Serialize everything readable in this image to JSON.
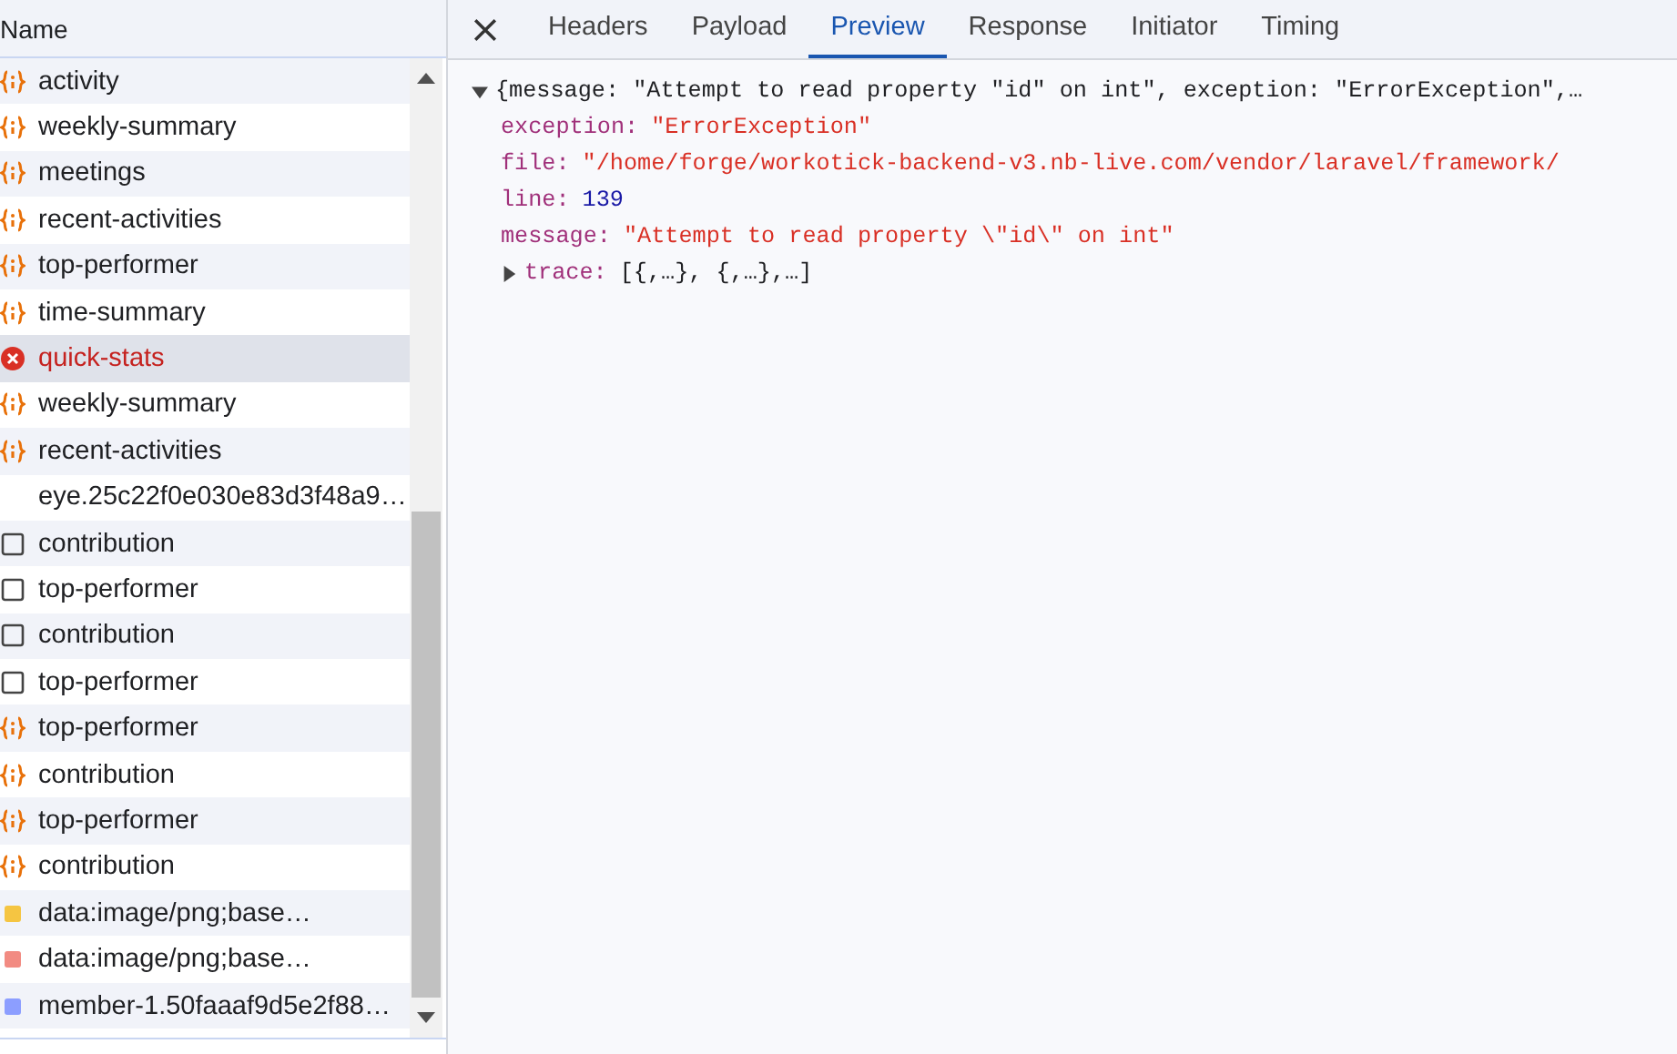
{
  "requests": {
    "header": "Name",
    "rows": [
      {
        "name": "activity",
        "kind": "fetch",
        "selected": false
      },
      {
        "name": "weekly-summary",
        "kind": "fetch",
        "selected": false
      },
      {
        "name": "meetings",
        "kind": "fetch",
        "selected": false
      },
      {
        "name": "recent-activities",
        "kind": "fetch",
        "selected": false
      },
      {
        "name": "top-performer",
        "kind": "fetch",
        "selected": false
      },
      {
        "name": "time-summary",
        "kind": "fetch",
        "selected": false
      },
      {
        "name": "quick-stats",
        "kind": "error",
        "selected": true
      },
      {
        "name": "weekly-summary",
        "kind": "fetch",
        "selected": false
      },
      {
        "name": "recent-activities",
        "kind": "fetch",
        "selected": false
      },
      {
        "name": "eye.25c22f0e030e83d3f48a9…",
        "kind": "other",
        "selected": false
      },
      {
        "name": "contribution",
        "kind": "document",
        "selected": false
      },
      {
        "name": "top-performer",
        "kind": "document",
        "selected": false
      },
      {
        "name": "contribution",
        "kind": "document",
        "selected": false
      },
      {
        "name": "top-performer",
        "kind": "document",
        "selected": false
      },
      {
        "name": "top-performer",
        "kind": "fetch",
        "selected": false
      },
      {
        "name": "contribution",
        "kind": "fetch",
        "selected": false
      },
      {
        "name": "top-performer",
        "kind": "fetch",
        "selected": false
      },
      {
        "name": "contribution",
        "kind": "fetch",
        "selected": false
      },
      {
        "name": "data:image/png;base…",
        "kind": "image",
        "color": "#f5c542",
        "selected": false
      },
      {
        "name": "data:image/png;base…",
        "kind": "image",
        "color": "#f28b82",
        "selected": false
      },
      {
        "name": "member-1.50faaaf9d5e2f88…",
        "kind": "image",
        "color": "#8c9eff",
        "selected": false
      }
    ]
  },
  "tabs": [
    {
      "label": "Headers",
      "selected": false
    },
    {
      "label": "Payload",
      "selected": false
    },
    {
      "label": "Preview",
      "selected": true
    },
    {
      "label": "Response",
      "selected": false
    },
    {
      "label": "Initiator",
      "selected": false
    },
    {
      "label": "Timing",
      "selected": false
    }
  ],
  "preview": {
    "summary": "{message: \"Attempt to read property \"id\" on int\", exception: \"ErrorException\",…",
    "expanded": true,
    "properties": [
      {
        "key": "exception:",
        "value": "\"ErrorException\"",
        "kind": "string"
      },
      {
        "key": "file:",
        "value": "\"/home/forge/workotick-backend-v3.nb-live.com/vendor/laravel/framework/",
        "kind": "string"
      },
      {
        "key": "line:",
        "value": "139",
        "kind": "number"
      },
      {
        "key": "message:",
        "value": "\"Attempt to read property \\\"id\\\" on int\"",
        "kind": "string"
      },
      {
        "key": "trace:",
        "value": "[{,…}, {,…},…]",
        "kind": "collapsed",
        "expanded": false
      }
    ]
  }
}
